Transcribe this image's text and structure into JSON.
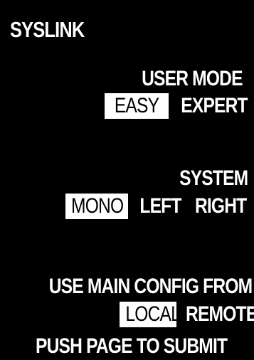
{
  "app": {
    "title": "SYSLINK"
  },
  "user_mode": {
    "label": "USER MODE",
    "options": [
      "EASY",
      "EXPERT"
    ],
    "selected": "EASY"
  },
  "system": {
    "label": "SYSTEM",
    "options": [
      "MONO",
      "LEFT",
      "RIGHT"
    ],
    "selected": "MONO"
  },
  "main_config": {
    "label": "USE MAIN CONFIG FROM",
    "options": [
      "LOCAL",
      "REMOTE"
    ],
    "selected": "LOCAL"
  },
  "footer": {
    "hint": "PUSH PAGE TO SUBMIT"
  },
  "colors": {
    "background": "#000000",
    "text": "#ffffff",
    "selected_bg": "#ffffff",
    "selected_text": "#000000"
  }
}
